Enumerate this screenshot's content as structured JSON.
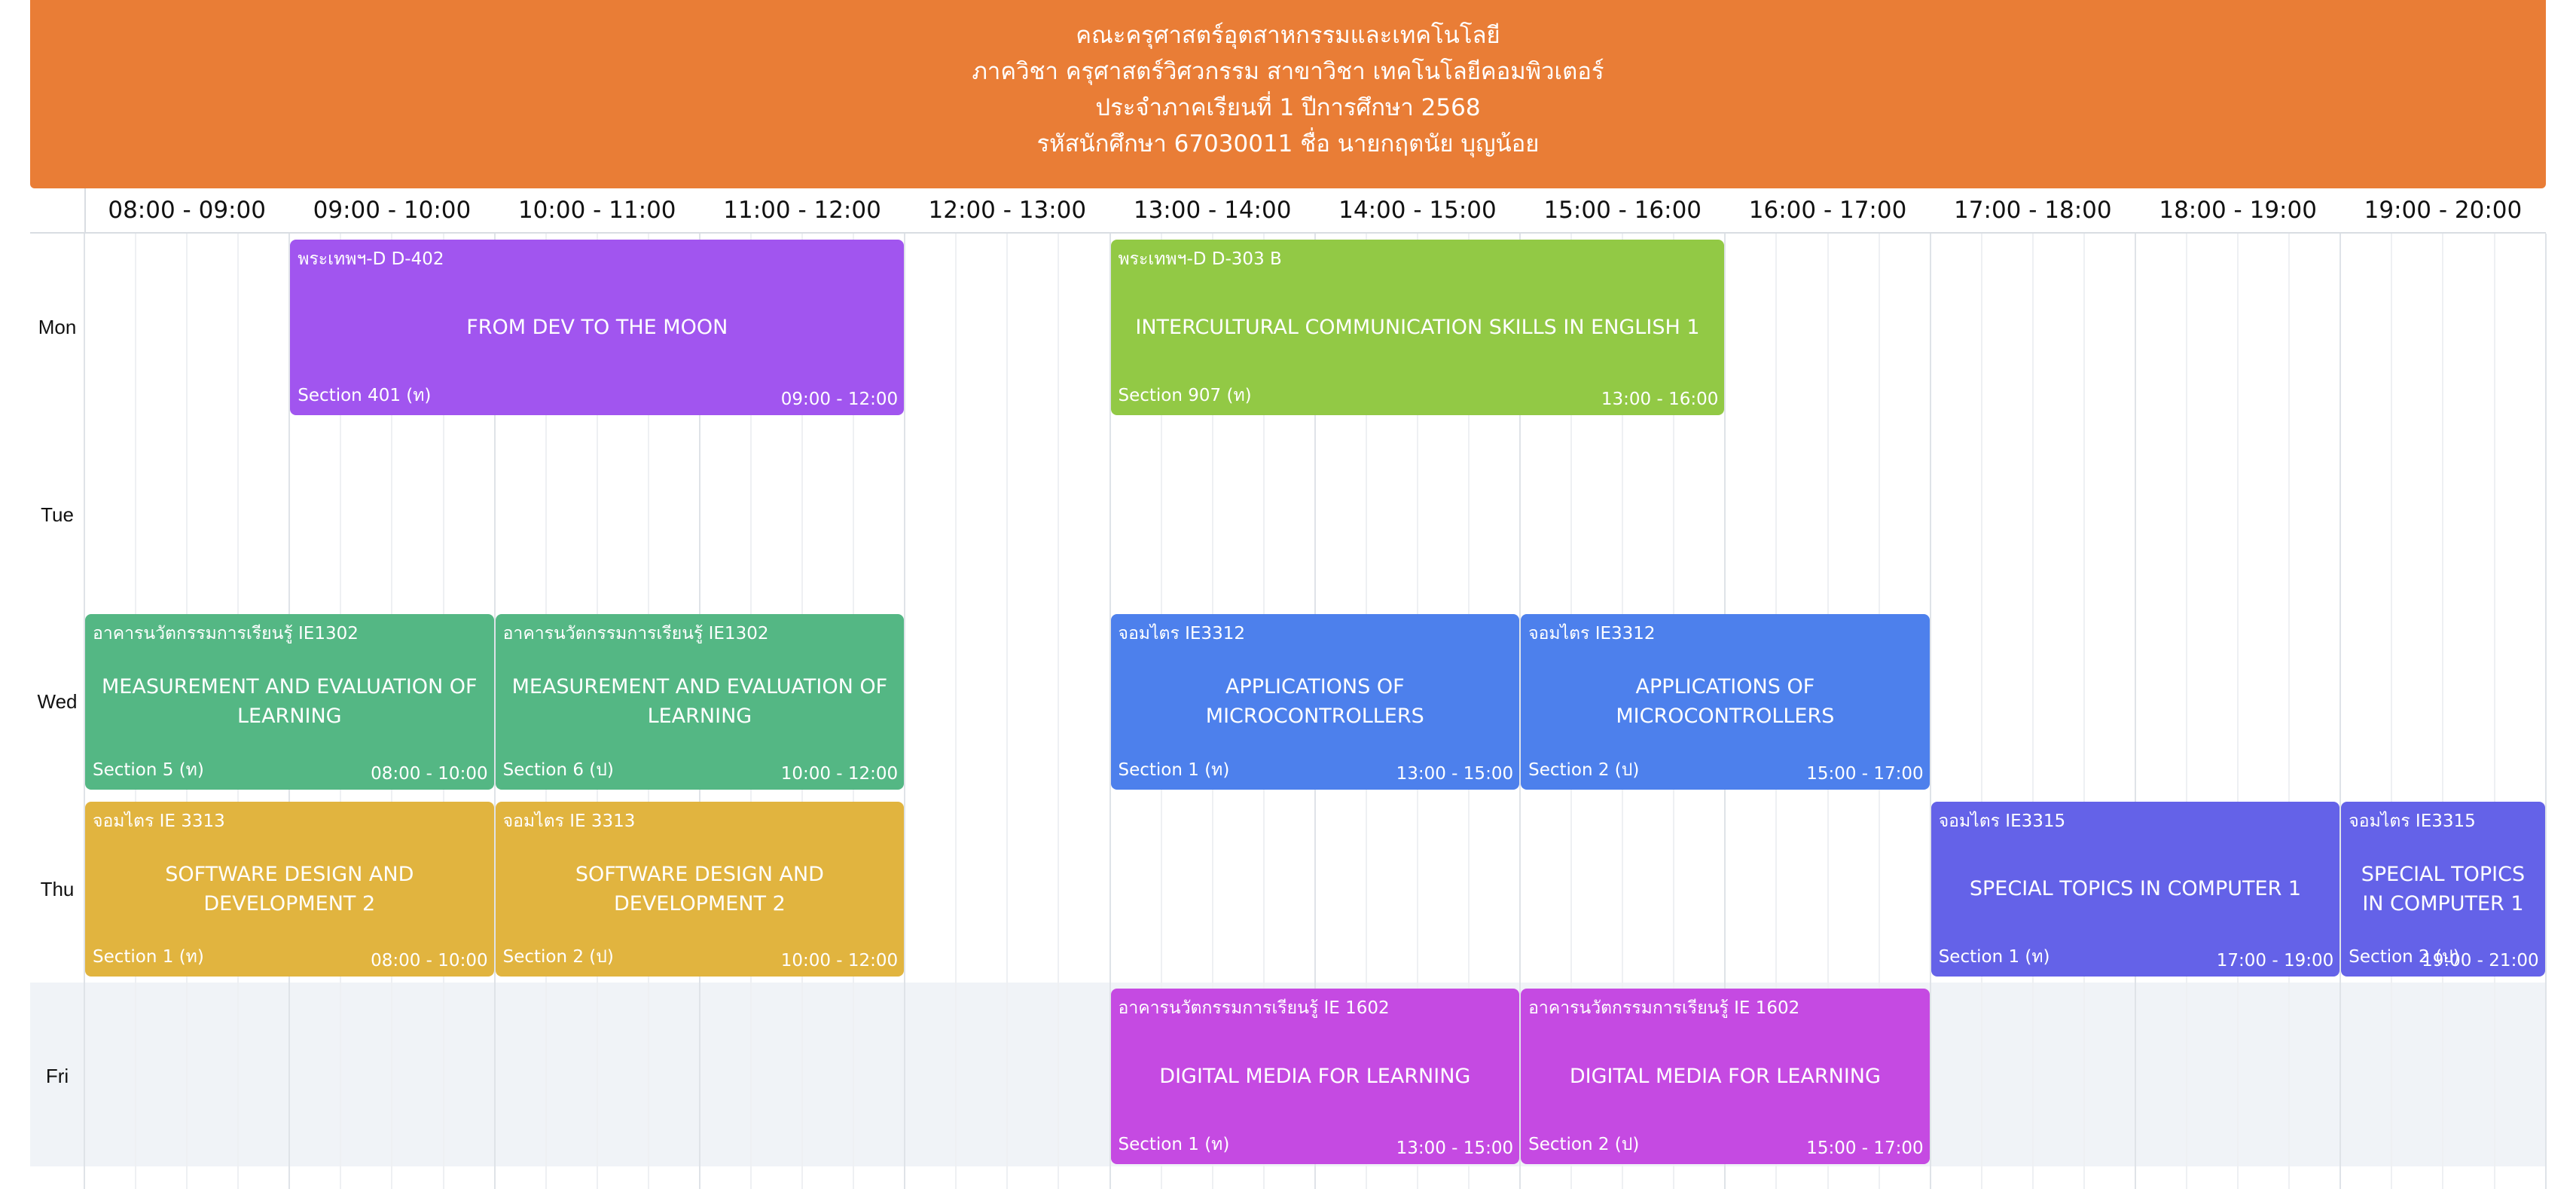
{
  "header": {
    "lines": [
      "คณะครุศาสตร์อุตสาหกรรมและเทคโนโลยี",
      "ภาควิชา ครุศาสตร์วิศวกรรม สาขาวิชา เทคโนโลยีคอมพิวเตอร์",
      "ประจำภาคเรียนที่ 1 ปีการศึกษา 2568",
      "รหัสนักศึกษา 67030011 ชื่อ นายกฤตนัย บุญน้อย"
    ]
  },
  "time_slots": [
    "08:00 - 09:00",
    "09:00 - 10:00",
    "10:00 - 11:00",
    "11:00 - 12:00",
    "12:00 - 13:00",
    "13:00 - 14:00",
    "14:00 - 15:00",
    "15:00 - 16:00",
    "16:00 - 17:00",
    "17:00 - 18:00",
    "18:00 - 19:00",
    "19:00 - 20:00"
  ],
  "days": [
    "Mon",
    "Tue",
    "Wed",
    "Thu",
    "Fri"
  ],
  "colors": {
    "header": "#E97D36",
    "purple": "#A155EF",
    "lime": "#92C945",
    "green": "#54B784",
    "blue": "#4D80EC",
    "mustard": "#E1B43F",
    "indigo": "#6462E8",
    "magenta": "#C54AE2"
  },
  "classes": [
    {
      "day": "Mon",
      "start": "09:00",
      "end": "12:00",
      "location": "พระเทพฯ-D D-402",
      "title": "FROM DEV TO THE MOON",
      "section": "Section 401 (ท)",
      "time": "09:00 - 12:00",
      "color": "#A155EF"
    },
    {
      "day": "Mon",
      "start": "13:00",
      "end": "16:00",
      "location": "พระเทพฯ-D D-303 B",
      "title": "INTERCULTURAL COMMUNICATION SKILLS IN ENGLISH 1",
      "section": "Section 907 (ท)",
      "time": "13:00 - 16:00",
      "color": "#92C945"
    },
    {
      "day": "Wed",
      "start": "08:00",
      "end": "10:00",
      "location": "อาคารนวัตกรรมการเรียนรู้ IE1302",
      "title": "MEASUREMENT AND EVALUATION OF LEARNING",
      "section": "Section 5 (ท)",
      "time": "08:00 - 10:00",
      "color": "#54B784"
    },
    {
      "day": "Wed",
      "start": "10:00",
      "end": "12:00",
      "location": "อาคารนวัตกรรมการเรียนรู้ IE1302",
      "title": "MEASUREMENT AND EVALUATION OF LEARNING",
      "section": "Section 6 (ป)",
      "time": "10:00 - 12:00",
      "color": "#54B784"
    },
    {
      "day": "Wed",
      "start": "13:00",
      "end": "15:00",
      "location": "จอมไตร IE3312",
      "title": "APPLICATIONS OF MICROCONTROLLERS",
      "section": "Section 1 (ท)",
      "time": "13:00 - 15:00",
      "color": "#4D80EC"
    },
    {
      "day": "Wed",
      "start": "15:00",
      "end": "17:00",
      "location": "จอมไตร IE3312",
      "title": "APPLICATIONS OF MICROCONTROLLERS",
      "section": "Section 2 (ป)",
      "time": "15:00 - 17:00",
      "color": "#4D80EC"
    },
    {
      "day": "Thu",
      "start": "08:00",
      "end": "10:00",
      "location": "จอมไตร IE 3313",
      "title": "SOFTWARE DESIGN AND DEVELOPMENT 2",
      "section": "Section 1 (ท)",
      "time": "08:00 - 10:00",
      "color": "#E1B43F"
    },
    {
      "day": "Thu",
      "start": "10:00",
      "end": "12:00",
      "location": "จอมไตร IE 3313",
      "title": "SOFTWARE DESIGN AND DEVELOPMENT 2",
      "section": "Section 2 (ป)",
      "time": "10:00 - 12:00",
      "color": "#E1B43F"
    },
    {
      "day": "Thu",
      "start": "17:00",
      "end": "19:00",
      "location": "จอมไตร IE3315",
      "title": "SPECIAL TOPICS IN COMPUTER 1",
      "section": "Section 1 (ท)",
      "time": "17:00 - 19:00",
      "color": "#6462E8"
    },
    {
      "day": "Thu",
      "start": "19:00",
      "end": "20:00",
      "location": "จอมไตร IE3315",
      "title": "SPECIAL TOPICS IN COMPUTER 1",
      "section": "Section 2 (ป)",
      "time": "19:00 - 21:00",
      "color": "#6462E8"
    },
    {
      "day": "Fri",
      "start": "13:00",
      "end": "15:00",
      "location": "อาคารนวัตกรรมการเรียนรู้ IE 1602",
      "title": "DIGITAL MEDIA FOR LEARNING",
      "section": "Section 1 (ท)",
      "time": "13:00 - 15:00",
      "color": "#C54AE2"
    },
    {
      "day": "Fri",
      "start": "15:00",
      "end": "17:00",
      "location": "อาคารนวัตกรรมการเรียนรู้ IE 1602",
      "title": "DIGITAL MEDIA FOR LEARNING",
      "section": "Section 2 (ป)",
      "time": "15:00 - 17:00",
      "color": "#C54AE2"
    }
  ]
}
